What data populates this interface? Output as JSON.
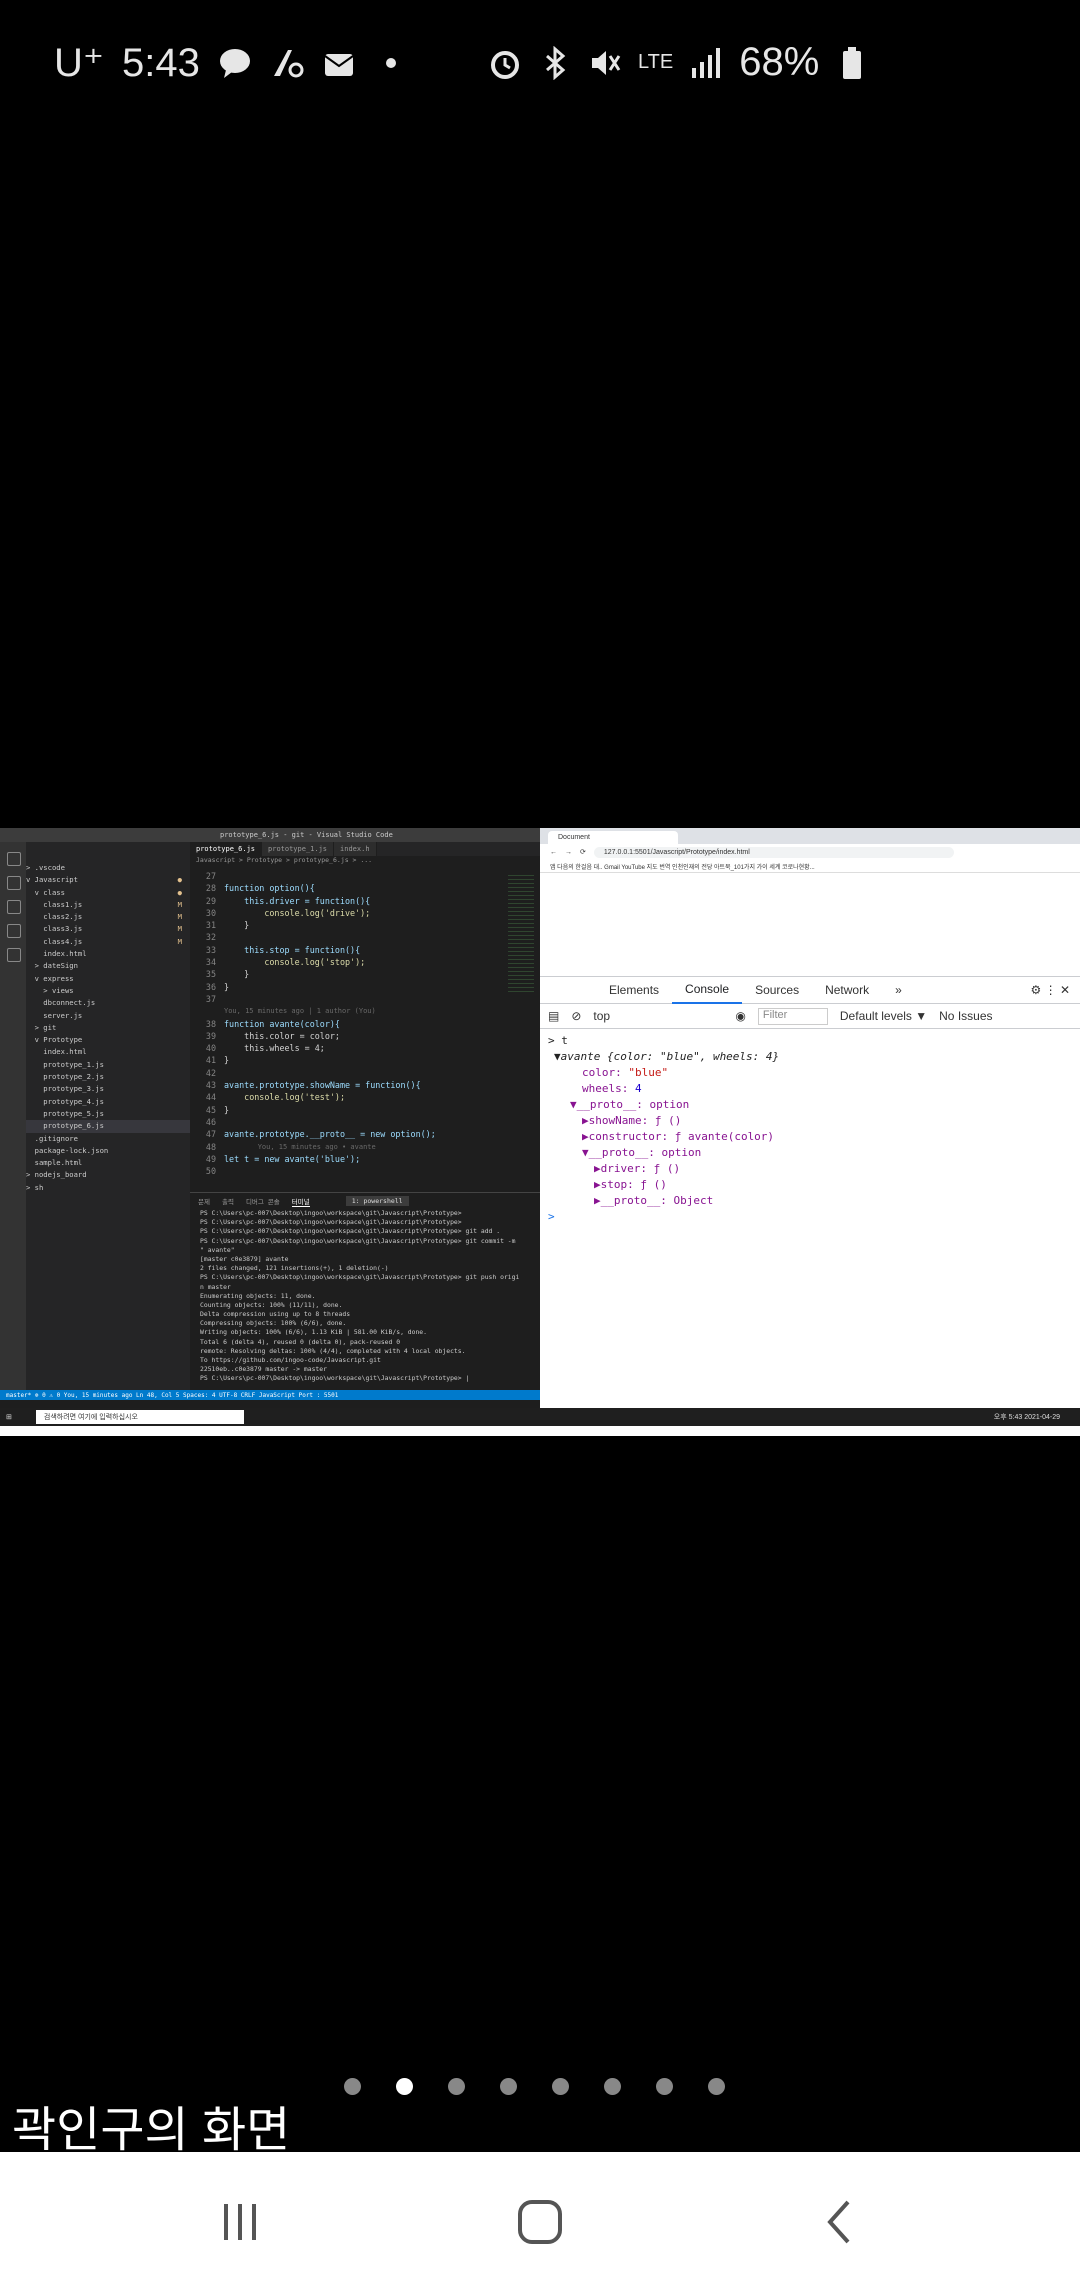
{
  "status_bar": {
    "carrier": "U⁺",
    "time": "5:43",
    "network": "LTE",
    "battery": "68%",
    "notif_icons": [
      "talk-icon",
      "key-icon",
      "mail-icon",
      "dot-icon"
    ],
    "right_icons": [
      "alarm-icon",
      "bluetooth-icon",
      "mute-icon",
      "signal-icon",
      "battery-icon"
    ]
  },
  "vscode": {
    "title": "prototype_6.js - git - Visual Studio Code",
    "tabs": [
      "prototype_6.js",
      "prototype_1.js",
      "index.h"
    ],
    "breadcrumb": "Javascript > Prototype > prototype_6.js > ...",
    "tree": [
      {
        "label": "> .vscode",
        "mark": ""
      },
      {
        "label": "v Javascript",
        "mark": "●"
      },
      {
        "label": "  v class",
        "mark": "●"
      },
      {
        "label": "    class1.js",
        "mark": "M"
      },
      {
        "label": "    class2.js",
        "mark": "M"
      },
      {
        "label": "    class3.js",
        "mark": "M"
      },
      {
        "label": "    class4.js",
        "mark": "M"
      },
      {
        "label": "    index.html",
        "mark": ""
      },
      {
        "label": "  > dateSign",
        "mark": ""
      },
      {
        "label": "  v express",
        "mark": ""
      },
      {
        "label": "    > views",
        "mark": ""
      },
      {
        "label": "    dbconnect.js",
        "mark": ""
      },
      {
        "label": "    server.js",
        "mark": ""
      },
      {
        "label": "  > git",
        "mark": ""
      },
      {
        "label": "  v Prototype",
        "mark": ""
      },
      {
        "label": "    index.html",
        "mark": ""
      },
      {
        "label": "    prototype_1.js",
        "mark": ""
      },
      {
        "label": "    prototype_2.js",
        "mark": ""
      },
      {
        "label": "    prototype_3.js",
        "mark": ""
      },
      {
        "label": "    prototype_4.js",
        "mark": ""
      },
      {
        "label": "    prototype_5.js",
        "mark": ""
      },
      {
        "label": "    prototype_6.js",
        "mark": ""
      },
      {
        "label": "  .gitignore",
        "mark": ""
      },
      {
        "label": "  package-lock.json",
        "mark": ""
      },
      {
        "label": "  sample.html",
        "mark": ""
      },
      {
        "label": "> nodejs_board",
        "mark": ""
      },
      {
        "label": "> sh",
        "mark": ""
      }
    ],
    "code": [
      {
        "n": "27",
        "t": ""
      },
      {
        "n": "28",
        "t": "function option(){"
      },
      {
        "n": "29",
        "t": "    this.driver = function(){"
      },
      {
        "n": "30",
        "t": "        console.log('drive');"
      },
      {
        "n": "31",
        "t": "    }"
      },
      {
        "n": "32",
        "t": ""
      },
      {
        "n": "33",
        "t": "    this.stop = function(){"
      },
      {
        "n": "34",
        "t": "        console.log('stop');"
      },
      {
        "n": "35",
        "t": "    }"
      },
      {
        "n": "36",
        "t": "}"
      },
      {
        "n": "37",
        "t": ""
      },
      {
        "n": "",
        "t": "You, 15 minutes ago | 1 author (You)"
      },
      {
        "n": "38",
        "t": "function avante(color){"
      },
      {
        "n": "39",
        "t": "    this.color = color;"
      },
      {
        "n": "40",
        "t": "    this.wheels = 4;"
      },
      {
        "n": "41",
        "t": "}"
      },
      {
        "n": "42",
        "t": ""
      },
      {
        "n": "43",
        "t": "avante.prototype.showName = function(){"
      },
      {
        "n": "44",
        "t": "    console.log('test');"
      },
      {
        "n": "45",
        "t": "}"
      },
      {
        "n": "46",
        "t": ""
      },
      {
        "n": "47",
        "t": "avante.prototype.__proto__ = new option();"
      },
      {
        "n": "48",
        "t": "        You, 15 minutes ago • avante"
      },
      {
        "n": "49",
        "t": "let t = new avante('blue');"
      },
      {
        "n": "50",
        "t": ""
      }
    ],
    "terminal_selector": "1: powershell",
    "terminal": [
      "PS C:\\Users\\pc-007\\Desktop\\ingoo\\workspace\\git\\Javascript\\Prototype>",
      "PS C:\\Users\\pc-007\\Desktop\\ingoo\\workspace\\git\\Javascript\\Prototype>",
      "PS C:\\Users\\pc-007\\Desktop\\ingoo\\workspace\\git\\Javascript\\Prototype> git add .",
      "PS C:\\Users\\pc-007\\Desktop\\ingoo\\workspace\\git\\Javascript\\Prototype> git commit -m",
      "\" avante\"",
      "[master c0e3879] avante",
      " 2 files changed, 121 insertions(+), 1 deletion(-)",
      "PS C:\\Users\\pc-007\\Desktop\\ingoo\\workspace\\git\\Javascript\\Prototype> git push origi",
      "n master",
      "Enumerating objects: 11, done.",
      "Counting objects: 100% (11/11), done.",
      "Delta compression using up to 8 threads",
      "Compressing objects: 100% (6/6), done.",
      "Writing objects: 100% (6/6), 1.13 KiB | 581.00 KiB/s, done.",
      "Total 6 (delta 4), reused 0 (delta 0), pack-reused 0",
      "remote: Resolving deltas: 100% (4/4), completed with 4 local objects.",
      "To https://github.com/ingoo-code/Javascript.git",
      "   22510eb..c0e3879  master -> master",
      "PS C:\\Users\\pc-007\\Desktop\\ingoo\\workspace\\git\\Javascript\\Prototype> |"
    ],
    "statusbar": "master*  ⊗ 0 ⚠ 0      You, 15 minutes ago   Ln 48, Col 5   Spaces: 4   UTF-8   CRLF   JavaScript   Port : 5501"
  },
  "chrome": {
    "tab_title": "Document",
    "url": "127.0.0.1:5501/Javascript/Prototype/index.html",
    "bookmarks": "앱  다음의 한걸음 대..  Gmail  YouTube  지도  번역  인천인재의 전당  아트북_101가지 가이  세계 코로나현황...",
    "devtools_tabs": [
      "Elements",
      "Console",
      "Sources",
      "Network",
      "»"
    ],
    "context": "top",
    "filter_placeholder": "Filter",
    "levels": "Default levels ▼",
    "issues": "No Issues",
    "console": {
      "input": "> t",
      "obj": "▼avante {color: \"blue\", wheels: 4}",
      "color": "\"blue\"",
      "wheels": "4",
      "proto1": "▼__proto__: option",
      "showName": "▶showName: ƒ ()",
      "constructor": "▶constructor: ƒ avante(color)",
      "proto2": "▼__proto__: option",
      "driver": "▶driver: ƒ ()",
      "stop": "▶stop: ƒ ()",
      "proto3": "▶__proto__: Object",
      "prompt": ">"
    }
  },
  "taskbar": {
    "search": "검색하려면 여기에 입력하십시오",
    "clock": "오후 5:43 2021-04-29"
  },
  "pager": {
    "count": 8,
    "active": 1
  },
  "caption": "곽인구의 화면"
}
